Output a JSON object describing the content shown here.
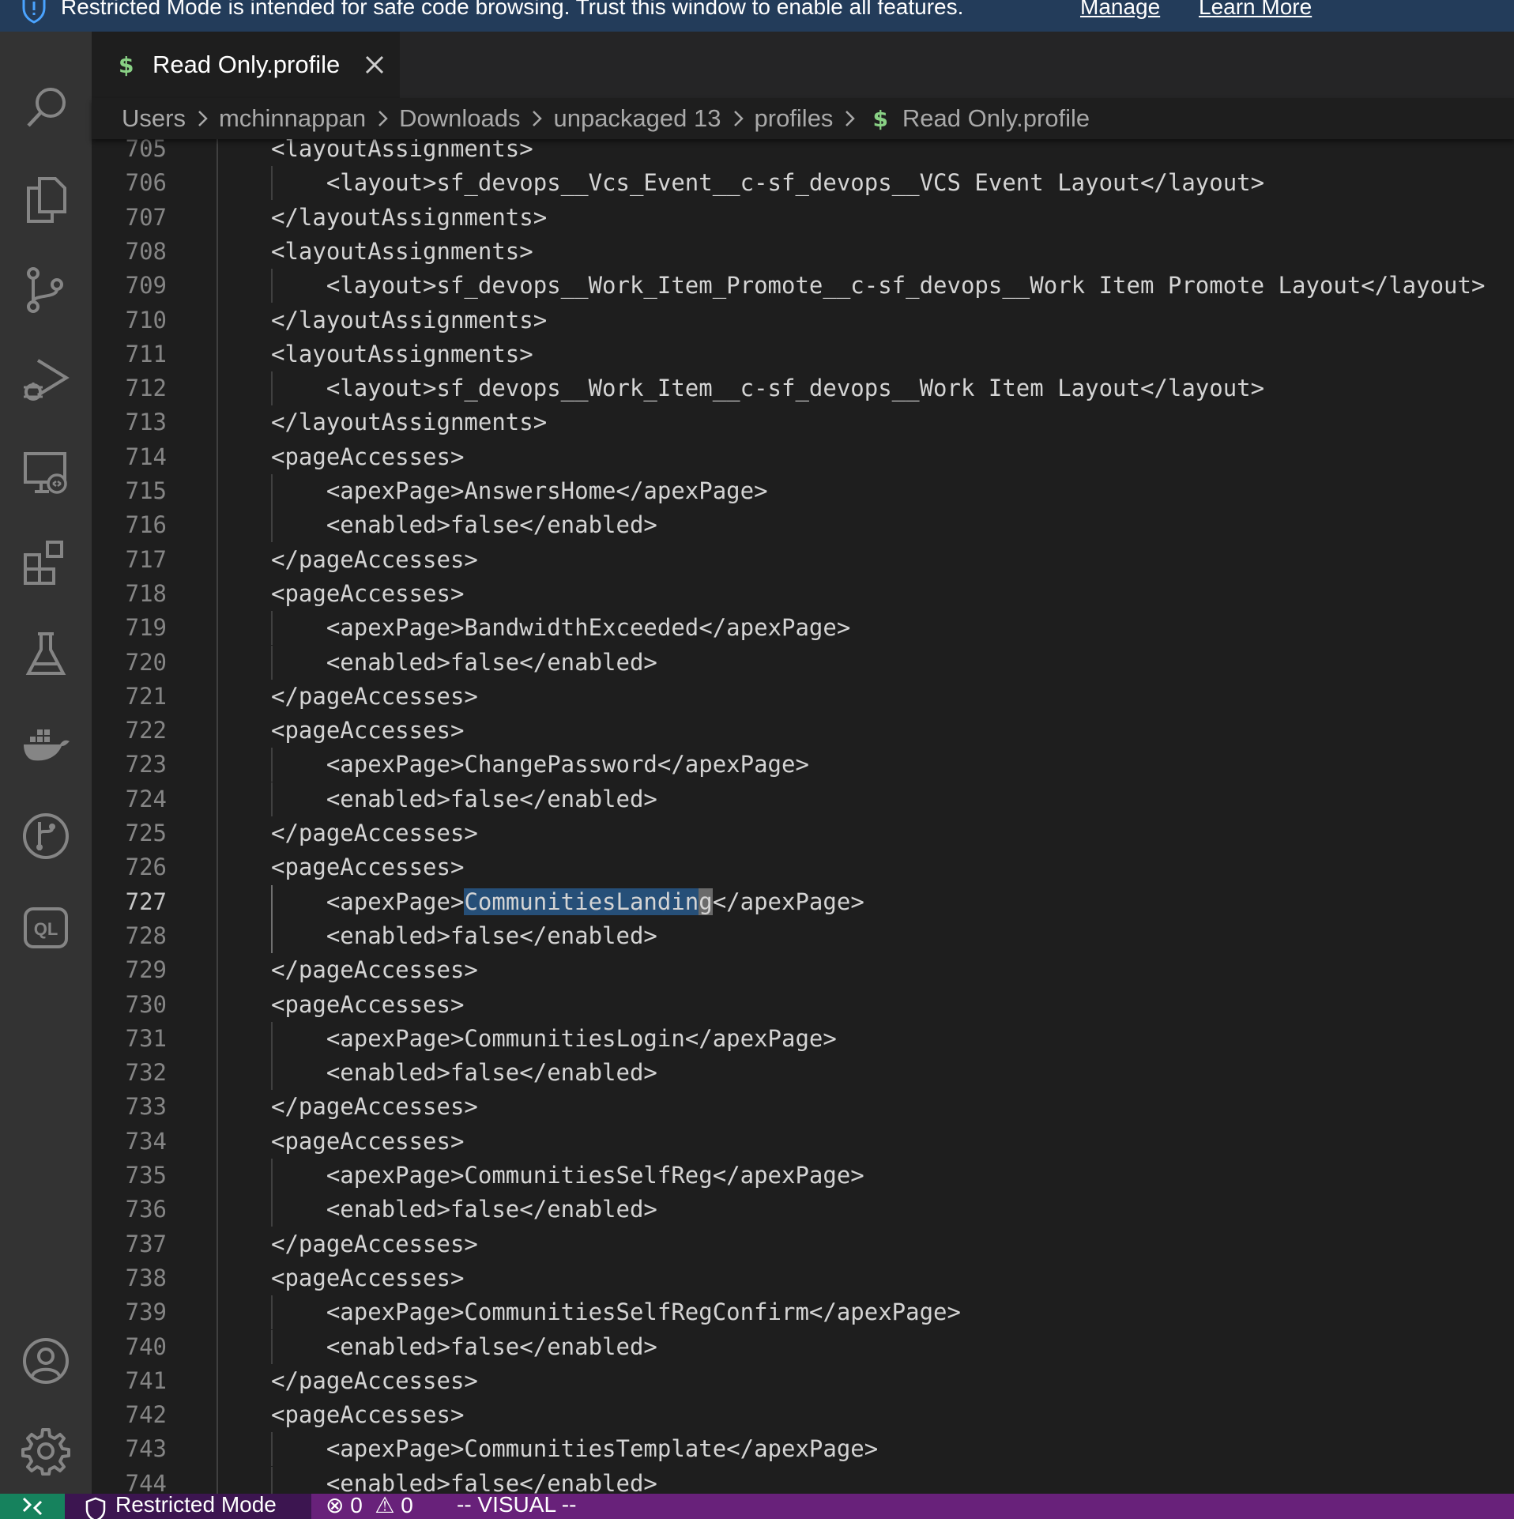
{
  "banner": {
    "message": "Restricted Mode is intended for safe code browsing. Trust this window to enable all features.",
    "manage_label": "Manage",
    "learn_more_label": "Learn More"
  },
  "activity_bar": {
    "top_icons": [
      "search-icon",
      "explorer-icon",
      "source-control-icon",
      "run-debug-icon",
      "remote-explorer-icon",
      "extensions-icon",
      "testing-icon",
      "docker-icon",
      "git-graph-icon",
      "codeql-icon"
    ],
    "bottom_icons": [
      "accounts-icon",
      "settings-gear-icon"
    ]
  },
  "tab": {
    "icon": "$",
    "label": "Read Only.profile"
  },
  "breadcrumb": {
    "items": [
      "Users",
      "mchinnappan",
      "Downloads",
      "unpackaged 13",
      "profiles"
    ],
    "file_icon": "$",
    "file": "Read Only.profile"
  },
  "editor": {
    "active_line": "727",
    "selection_text": "CommunitiesLandin",
    "cursor_char": "g",
    "lines": [
      {
        "n": "705",
        "text": "<layoutAssignments>"
      },
      {
        "n": "706",
        "text": "    <layout>sf_devops__Vcs_Event__c-sf_devops__VCS Event Layout</layout>"
      },
      {
        "n": "707",
        "text": "</layoutAssignments>"
      },
      {
        "n": "708",
        "text": "<layoutAssignments>"
      },
      {
        "n": "709",
        "text": "    <layout>sf_devops__Work_Item_Promote__c-sf_devops__Work Item Promote Layout</layout>"
      },
      {
        "n": "710",
        "text": "</layoutAssignments>"
      },
      {
        "n": "711",
        "text": "<layoutAssignments>"
      },
      {
        "n": "712",
        "text": "    <layout>sf_devops__Work_Item__c-sf_devops__Work Item Layout</layout>"
      },
      {
        "n": "713",
        "text": "</layoutAssignments>"
      },
      {
        "n": "714",
        "text": "<pageAccesses>"
      },
      {
        "n": "715",
        "text": "    <apexPage>AnswersHome</apexPage>"
      },
      {
        "n": "716",
        "text": "    <enabled>false</enabled>"
      },
      {
        "n": "717",
        "text": "</pageAccesses>"
      },
      {
        "n": "718",
        "text": "<pageAccesses>"
      },
      {
        "n": "719",
        "text": "    <apexPage>BandwidthExceeded</apexPage>"
      },
      {
        "n": "720",
        "text": "    <enabled>false</enabled>"
      },
      {
        "n": "721",
        "text": "</pageAccesses>"
      },
      {
        "n": "722",
        "text": "<pageAccesses>"
      },
      {
        "n": "723",
        "text": "    <apexPage>ChangePassword</apexPage>"
      },
      {
        "n": "724",
        "text": "    <enabled>false</enabled>"
      },
      {
        "n": "725",
        "text": "</pageAccesses>"
      },
      {
        "n": "726",
        "text": "<pageAccesses>"
      },
      {
        "n": "727",
        "text": "    <apexPage>CommunitiesLanding</apexPage>"
      },
      {
        "n": "728",
        "text": "    <enabled>false</enabled>"
      },
      {
        "n": "729",
        "text": "</pageAccesses>"
      },
      {
        "n": "730",
        "text": "<pageAccesses>"
      },
      {
        "n": "731",
        "text": "    <apexPage>CommunitiesLogin</apexPage>"
      },
      {
        "n": "732",
        "text": "    <enabled>false</enabled>"
      },
      {
        "n": "733",
        "text": "</pageAccesses>"
      },
      {
        "n": "734",
        "text": "<pageAccesses>"
      },
      {
        "n": "735",
        "text": "    <apexPage>CommunitiesSelfReg</apexPage>"
      },
      {
        "n": "736",
        "text": "    <enabled>false</enabled>"
      },
      {
        "n": "737",
        "text": "</pageAccesses>"
      },
      {
        "n": "738",
        "text": "<pageAccesses>"
      },
      {
        "n": "739",
        "text": "    <apexPage>CommunitiesSelfRegConfirm</apexPage>"
      },
      {
        "n": "740",
        "text": "    <enabled>false</enabled>"
      },
      {
        "n": "741",
        "text": "</pageAccesses>"
      },
      {
        "n": "742",
        "text": "<pageAccesses>"
      },
      {
        "n": "743",
        "text": "    <apexPage>CommunitiesTemplate</apexPage>"
      },
      {
        "n": "744",
        "text": "    <enabled>false</enabled>"
      }
    ]
  },
  "status_bar": {
    "restricted_label": "Restricted Mode",
    "errors": "0",
    "warnings": "0",
    "mode": "-- VISUAL --"
  },
  "colors": {
    "banner_bg": "#233c5a",
    "activity_bar_bg": "#333333",
    "editor_bg": "#1e1e1e",
    "status_bar_bg": "#68217a",
    "selection_bg": "#264f78",
    "file_icon": "#89d185"
  }
}
